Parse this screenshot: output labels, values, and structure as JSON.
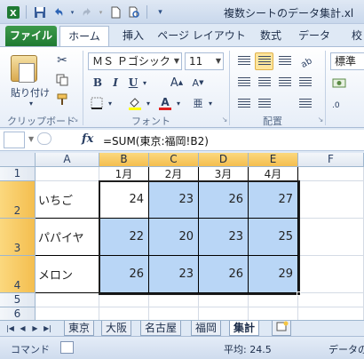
{
  "window": {
    "title": "複数シートのデータ集計.xl",
    "qat": {
      "save_icon": "save-icon",
      "undo_icon": "undo-icon",
      "redo_icon": "redo-icon",
      "new_icon": "new-doc-icon",
      "preview_icon": "print-preview-icon"
    }
  },
  "ribbon_tabs": [
    "ファイル",
    "ホーム",
    "挿入",
    "ページ レイアウト",
    "数式",
    "データ",
    "校"
  ],
  "ribbon": {
    "paste_label": "貼り付け",
    "clipboard_label": "クリップボード",
    "font_label": "フォント",
    "alignment_label": "配置",
    "font_name": "ＭＳ Ｐゴシック",
    "font_size": "11",
    "number_format": "標準",
    "bold": "B",
    "italic": "I",
    "underline": "U",
    "grow_font": "A",
    "shrink_font": "A",
    "font_color": "A",
    "phonetic": "亜"
  },
  "formula_bar": {
    "fx": "fx",
    "formula": "=SUM(東京:福岡!B2)"
  },
  "grid": {
    "columns": [
      "A",
      "B",
      "C",
      "D",
      "E",
      "F"
    ],
    "rows": [
      "1",
      "2",
      "3",
      "4",
      "5",
      "6"
    ],
    "headers": [
      "1月",
      "2月",
      "3月",
      "4月"
    ],
    "items": [
      {
        "name": "いちご",
        "values": [
          "24",
          "23",
          "26",
          "27"
        ]
      },
      {
        "name": "パパイヤ",
        "values": [
          "22",
          "20",
          "23",
          "25"
        ]
      },
      {
        "name": "メロン",
        "values": [
          "26",
          "23",
          "26",
          "29"
        ]
      }
    ]
  },
  "sheets": [
    "東京",
    "大阪",
    "名古屋",
    "福岡",
    "集計"
  ],
  "active_sheet": "集計",
  "status": {
    "mode": "コマンド",
    "average": "平均: 24.5",
    "count": "データの"
  },
  "colors": {
    "selection_fill": "#b9d6f6",
    "header_highlight": "#f4be4f",
    "file_tab": "#1f7a33"
  }
}
